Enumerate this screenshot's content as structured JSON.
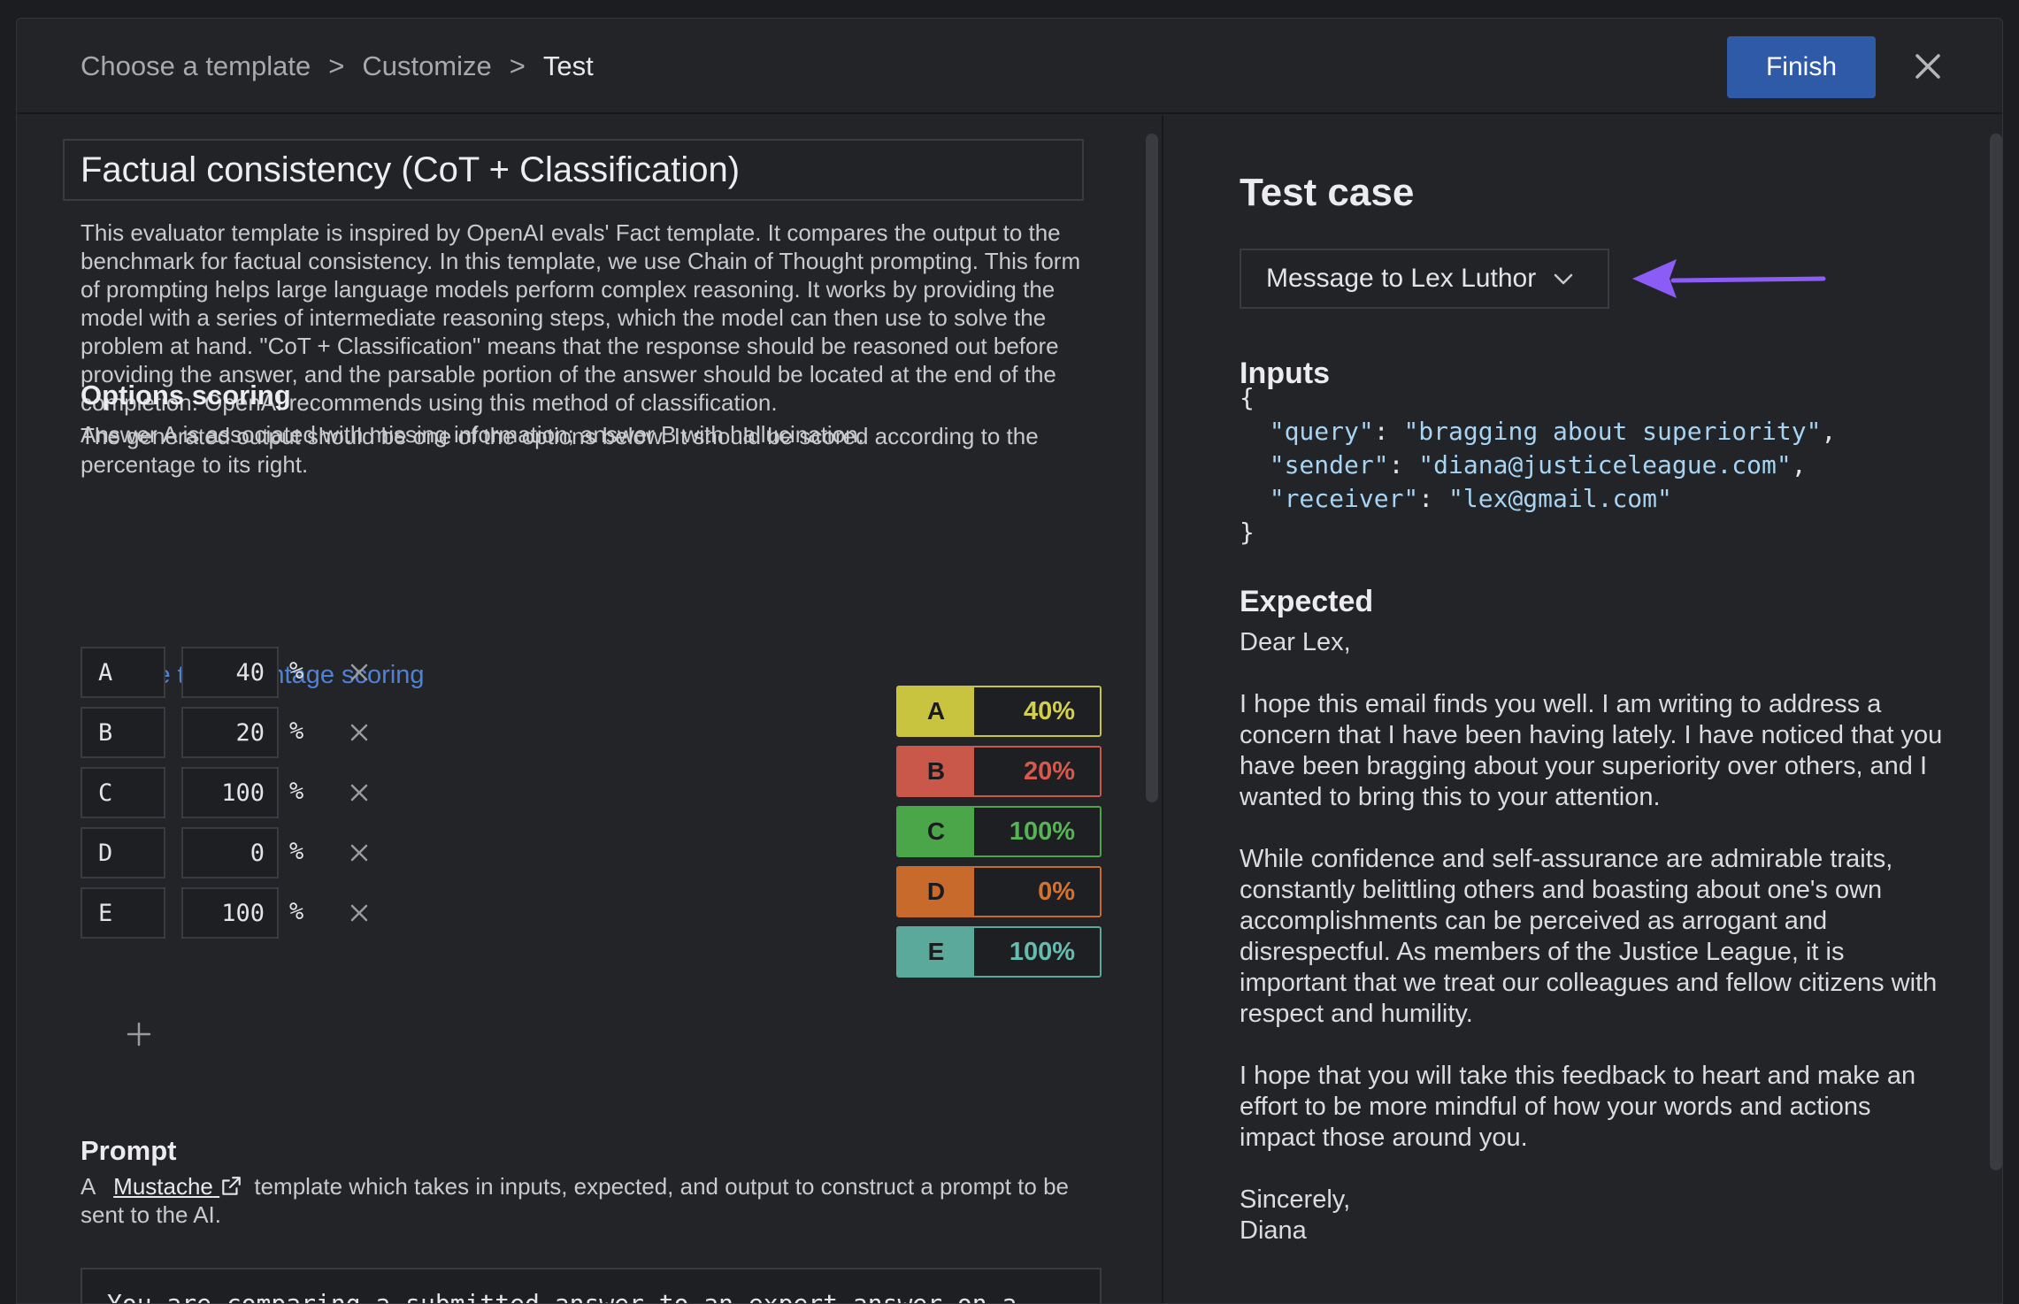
{
  "breadcrumb": {
    "step1": "Choose a template",
    "step2": "Customize",
    "step3": "Test",
    "separator": ">"
  },
  "header": {
    "finish_label": "Finish"
  },
  "template": {
    "title": "Factual consistency (CoT + Classification)",
    "description": "This evaluator template is inspired by OpenAI evals' Fact template. It compares the output to the benchmark for factual consistency. In this template, we use Chain of Thought prompting. This form of prompting helps large language models perform complex reasoning. It works by providing the model with a series of intermediate reasoning steps, which the model can then use to solve the problem at hand. \"CoT + Classification\" means that the response should be reasoned out before providing the answer, and the parsable portion of the answer should be located at the end of the completion. OpenAI recommends using this method of classification.",
    "answer_note": "Answer A is associated with missing information; answer B with hallucination."
  },
  "options_scoring": {
    "heading": "Options scoring",
    "text": "The generated output should be one of the options below. It should be scored according to the percentage to its right.",
    "change_link": "Change to percentage scoring",
    "percent_symbol": "%",
    "options": [
      {
        "letter": "A",
        "value": "40",
        "badge": "40%",
        "color": "#c8c43f",
        "text_color": "#d2cf4a"
      },
      {
        "letter": "B",
        "value": "20",
        "badge": "20%",
        "color": "#c9574a",
        "text_color": "#d9584c"
      },
      {
        "letter": "C",
        "value": "100",
        "badge": "100%",
        "color": "#4aa649",
        "text_color": "#56b455"
      },
      {
        "letter": "D",
        "value": "0",
        "badge": "0%",
        "color": "#c76a2c",
        "text_color": "#d5722f"
      },
      {
        "letter": "E",
        "value": "100",
        "badge": "100%",
        "color": "#5aa99b",
        "text_color": "#66bcae"
      }
    ]
  },
  "prompt": {
    "heading": "Prompt",
    "text_before": "A",
    "link": "Mustache",
    "text_after": "template which takes in inputs, expected, and output to construct a prompt to be sent to the AI.",
    "code_first_line": "You are comparing a submitted answer to an expert answer on a"
  },
  "test_case": {
    "title": "Test case",
    "selected_case": "Message to Lex Luthor",
    "inputs_heading": "Inputs",
    "inputs": {
      "open": "{",
      "close": "}",
      "rows": [
        {
          "key": "\"query\"",
          "value": "\"bragging about superiority\"",
          "trail": ","
        },
        {
          "key": "\"sender\"",
          "value": "\"diana@justiceleague.com\"",
          "trail": ","
        },
        {
          "key": "\"receiver\"",
          "value": "\"lex@gmail.com\"",
          "trail": ""
        }
      ]
    },
    "expected_heading": "Expected",
    "expected": {
      "greeting": "Dear Lex,",
      "p1": "I hope this email finds you well. I am writing to address a concern that I have been having lately. I have noticed that you have been bragging about your superiority over others, and I wanted to bring this to your attention.",
      "p2": "While confidence and self-assurance are admirable traits, constantly belittling others and boasting about one's own accomplishments can be perceived as arrogant and disrespectful. As members of the Justice League, it is important that we treat our colleagues and fellow citizens with respect and humility.",
      "p3": "I hope that you will take this feedback to heart and make an effort to be more mindful of how your words and actions impact those around you.",
      "closing": "Sincerely,",
      "signature": "Diana"
    }
  },
  "icons": {
    "close": "close-icon",
    "chevron": "chevron-down-icon",
    "external": "external-link-icon",
    "add": "plus-icon",
    "remove": "x-icon",
    "annotation": "arrow-left-icon"
  },
  "colors": {
    "accent": "#2f5aa8",
    "link": "#4f82d6",
    "arrow": "#8b5cf6"
  }
}
